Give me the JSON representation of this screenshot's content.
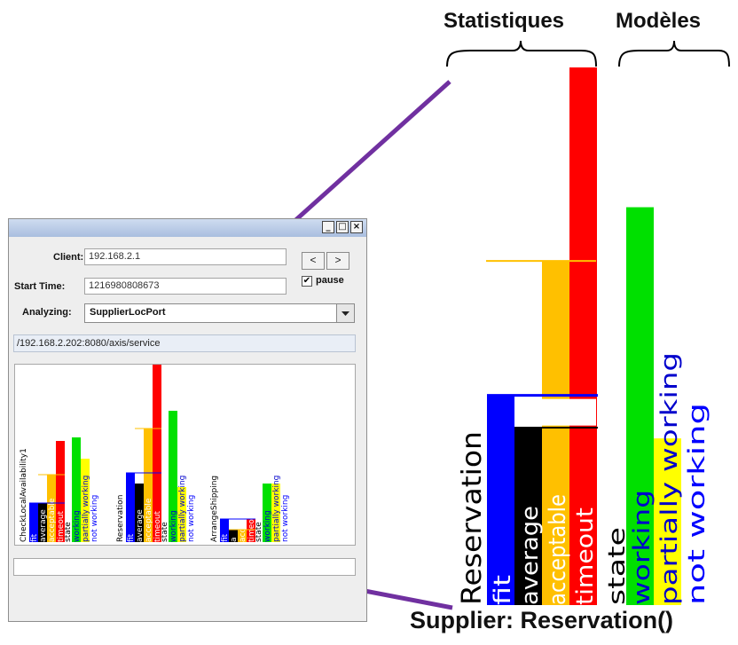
{
  "annotations": {
    "stats_heading": "Statistiques",
    "models_heading": "Modèles",
    "caption": "Supplier: Reservation()"
  },
  "window": {
    "title_buttons": [
      "_",
      "□",
      "×"
    ],
    "client_label": "Client:",
    "client_value": "192.168.2.1",
    "start_label": "Start Time:",
    "start_value": "1216980808673",
    "prev_label": "<",
    "next_label": ">",
    "pause_label": "pause",
    "pause_checked": true,
    "analyzing_label": "Analyzing:",
    "analyzing_value": "SupplierLocPort",
    "path_value": "/192.168.2.202:8080/axis/service"
  },
  "colors": {
    "fit": "#0000ff",
    "average": "#000000",
    "acceptable": "#ffc000",
    "timeout": "#ff0000",
    "working": "#00e000",
    "partially": "#ffff00",
    "notworking_text": "#0000ff",
    "purple": "#7030a0"
  },
  "chart_data": [
    {
      "type": "bar",
      "title": "",
      "groups": [
        {
          "name": "CheckLocalAvailability1",
          "statistics": [
            {
              "label": "fit",
              "value": 0.22
            },
            {
              "label": "average",
              "value": 0.22
            },
            {
              "label": "acceptable",
              "value": 0.38
            },
            {
              "label": "timeout",
              "value": 0.57
            }
          ],
          "state_label": "state",
          "models": [
            {
              "label": "working",
              "value": 0.59
            },
            {
              "label": "partially working",
              "value": 0.47
            },
            {
              "label": "not working",
              "value": 0
            }
          ]
        },
        {
          "name": "Reservation",
          "statistics": [
            {
              "label": "fit",
              "value": 0.39
            },
            {
              "label": "average",
              "value": 0.33
            },
            {
              "label": "acceptable",
              "value": 0.64
            },
            {
              "label": "timeout",
              "value": 1.0
            }
          ],
          "state_label": "state",
          "models": [
            {
              "label": "working",
              "value": 0.74
            },
            {
              "label": "partially working",
              "value": 0.31
            },
            {
              "label": "not working",
              "value": 0
            }
          ]
        },
        {
          "name": "ArrangeShipping",
          "statistics": [
            {
              "label": "fit",
              "value": 0.13
            },
            {
              "label": "a",
              "value": 0.07
            },
            {
              "label": "acceptable",
              "value": 0.07
            },
            {
              "label": "timeout",
              "value": 0.13
            }
          ],
          "state_label": "state",
          "models": [
            {
              "label": "working",
              "value": 0.33
            },
            {
              "label": "partially working",
              "value": 0.33
            },
            {
              "label": "not working",
              "value": 0
            }
          ]
        }
      ]
    },
    {
      "type": "bar",
      "title": "",
      "group_name": "Reservation",
      "statistics": [
        {
          "label": "fit",
          "value": 0.39
        },
        {
          "label": "average",
          "value": 0.33
        },
        {
          "label": "acceptable",
          "value": 0.64
        },
        {
          "label": "timeout",
          "value": 1.0
        }
      ],
      "state_label": "state",
      "models": [
        {
          "label": "working",
          "value": 0.74
        },
        {
          "label": "partially working",
          "value": 0.31
        },
        {
          "label": "not working",
          "value": 0
        }
      ]
    }
  ]
}
